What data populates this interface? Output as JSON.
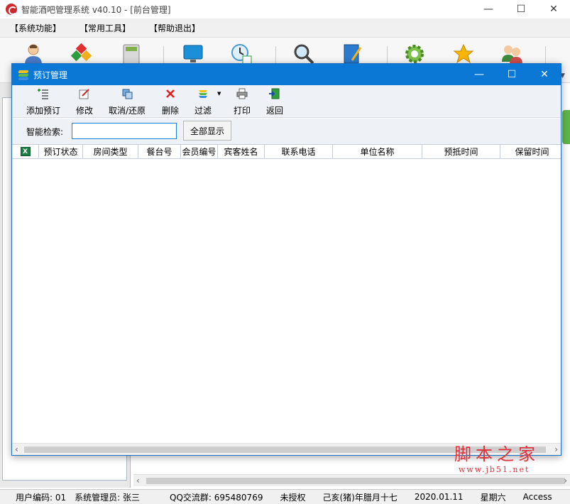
{
  "app": {
    "title": "智能酒吧管理系统 v40.10 - [前台管理]",
    "accent": "#0a78d4"
  },
  "window_controls": {
    "minimize": "—",
    "maximize": "☐",
    "close": "✕"
  },
  "menubar": {
    "items": [
      {
        "label": "【系统功能】"
      },
      {
        "label": "【常用工具】"
      },
      {
        "label": "【帮助退出】"
      }
    ]
  },
  "main_toolbar": {
    "icons": [
      "user-icon",
      "cubes-icon",
      "calculator-icon",
      "monitor-icon",
      "clock-calendar-icon",
      "magnifier-icon",
      "notebook-pen-icon",
      "gear-icon",
      "star-icon",
      "users-icon"
    ]
  },
  "dialog": {
    "title": "预订管理",
    "controls": {
      "minimize": "—",
      "maximize": "☐",
      "close": "✕"
    },
    "toolbar": {
      "add": "添加预订",
      "edit": "修改",
      "cancel_restore": "取消/还原",
      "delete": "删除",
      "filter": "过滤",
      "print": "打印",
      "back": "返回"
    },
    "search": {
      "label": "智能检索:",
      "value": "",
      "show_all": "全部显示"
    },
    "grid": {
      "columns": [
        "预订状态",
        "房间类型",
        "餐台号",
        "会员编号",
        "宾客姓名",
        "联系电话",
        "单位名称",
        "预抵时间",
        "保留时间"
      ],
      "rows": []
    }
  },
  "statusbar": {
    "user_code": "用户编码: 01",
    "operator": "系统管理员: 张三",
    "qq_group": "QQ交流群: 695480769",
    "license": "未授权",
    "lunar_date": "己亥(猪)年腊月十七",
    "date": "2020.01.11",
    "weekday": "星期六",
    "db": "Access"
  },
  "watermark": {
    "main": "脚本之家",
    "sub": "www.jb51.net"
  }
}
